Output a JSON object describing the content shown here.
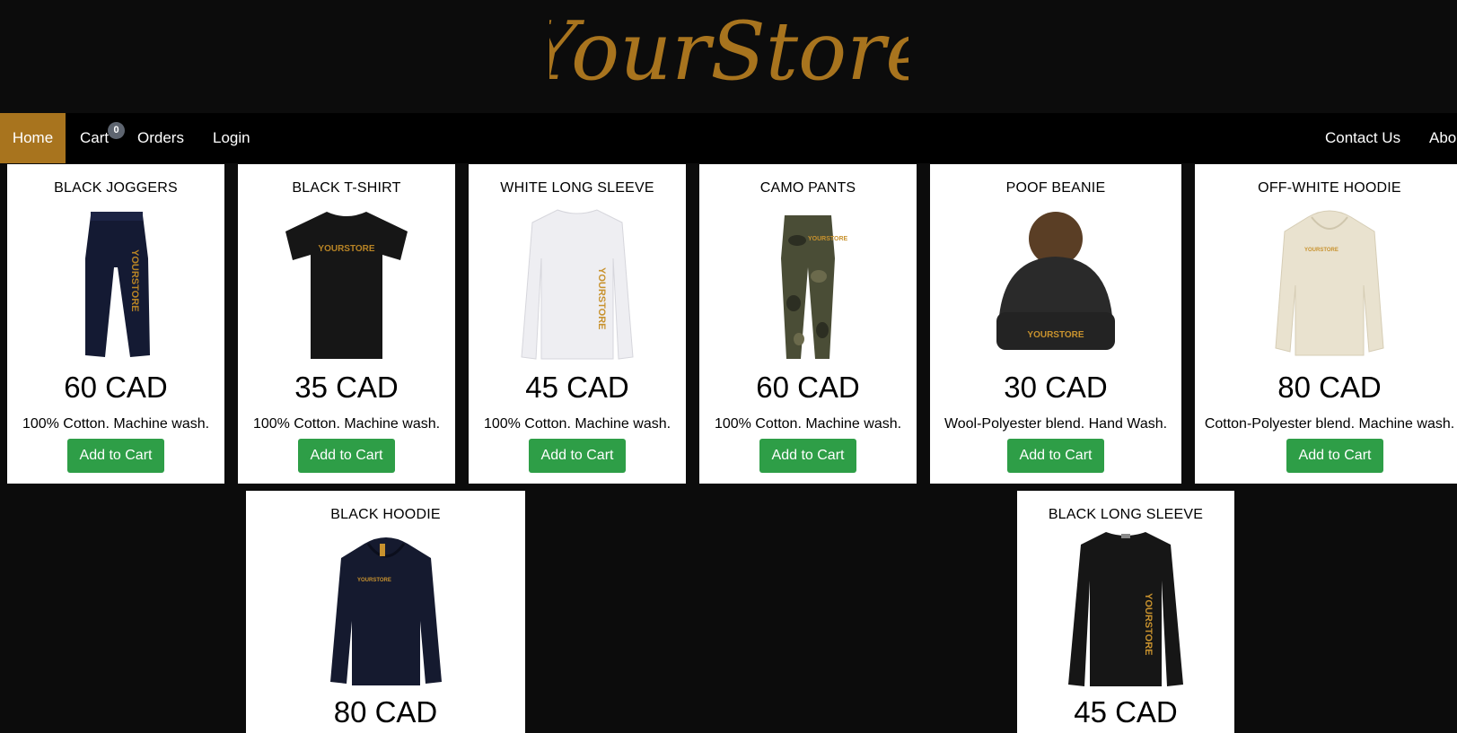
{
  "header": {
    "logo_text": "YourStore"
  },
  "nav": {
    "home": "Home",
    "cart": "Cart",
    "cart_count": "0",
    "orders": "Orders",
    "login": "Login",
    "contact": "Contact Us",
    "about": "Abo"
  },
  "colors": {
    "brand": "#a8741e",
    "button": "#2e9e47",
    "background": "#0c0c0c",
    "nav_bg": "#000000"
  },
  "products": [
    {
      "name": "BLACK JOGGERS",
      "price": "60 CAD",
      "desc": "100% Cotton. Machine wash.",
      "button": "Add to Cart",
      "icon": "joggers-image"
    },
    {
      "name": "BLACK T-SHIRT",
      "price": "35 CAD",
      "desc": "100% Cotton. Machine wash.",
      "button": "Add to Cart",
      "icon": "tshirt-image",
      "print": "YOURSTORE"
    },
    {
      "name": "WHITE LONG SLEEVE",
      "price": "45 CAD",
      "desc": "100% Cotton. Machine wash.",
      "button": "Add to Cart",
      "icon": "long-sleeve-image"
    },
    {
      "name": "CAMO PANTS",
      "price": "60 CAD",
      "desc": "100% Cotton. Machine wash.",
      "button": "Add to Cart",
      "icon": "camo-pants-image"
    },
    {
      "name": "POOF BEANIE",
      "price": "30 CAD",
      "desc": "Wool-Polyester blend. Hand Wash.",
      "button": "Add to Cart",
      "icon": "beanie-image",
      "print": "YOURSTORE"
    },
    {
      "name": "OFF-WHITE HOODIE",
      "price": "80 CAD",
      "desc": "Cotton-Polyester blend. Machine wash.",
      "button": "Add to Cart",
      "icon": "hoodie-image"
    },
    {
      "name": "BLACK HOODIE",
      "price": "80 CAD",
      "icon": "hoodie-image"
    },
    {
      "name": "BLACK LONG SLEEVE",
      "price": "45 CAD",
      "icon": "long-sleeve-image"
    }
  ]
}
